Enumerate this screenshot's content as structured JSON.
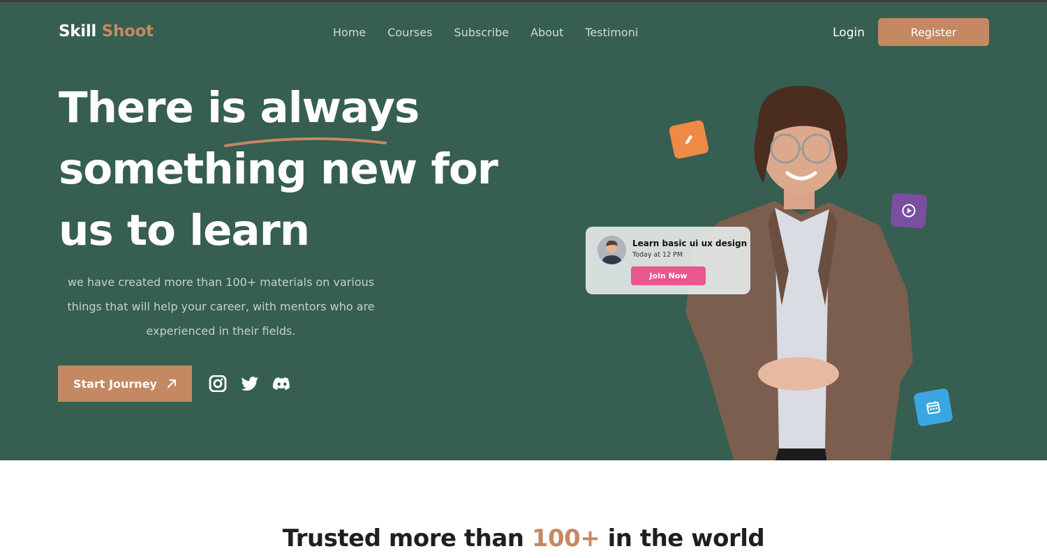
{
  "brand": {
    "name_part1": "Skill",
    "name_part2": "Shoot"
  },
  "nav": {
    "items": [
      "Home",
      "Courses",
      "Subscribe",
      "About",
      "Testimoni"
    ]
  },
  "auth": {
    "login": "Login",
    "register": "Register"
  },
  "hero": {
    "headline_part1": "There is always",
    "headline_part2": "something new for",
    "headline_part3": "us to learn",
    "description": "we have created more than 100+ materials on various things that will help your career, with mentors who are experienced in their fields.",
    "cta": "Start Journey"
  },
  "social": [
    "instagram-icon",
    "twitter-icon",
    "discord-icon"
  ],
  "course_card": {
    "title": "Learn basic ui ux design",
    "time": "Today at 12 PM",
    "button": "Join Now"
  },
  "trusted": {
    "prefix": "Trusted more than ",
    "highlight": "100+",
    "suffix": " in the world"
  },
  "colors": {
    "hero_bg": "#365e51",
    "accent": "#c48962",
    "join_button": "#e8578e",
    "pencil_icon_bg": "#ef8a44",
    "play_icon_bg": "#7a4fa1",
    "calendar_icon_bg": "#3aa7e3"
  }
}
